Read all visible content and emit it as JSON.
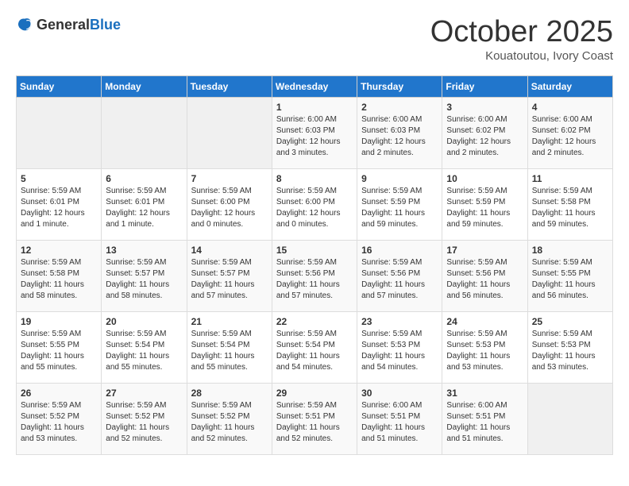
{
  "header": {
    "logo_general": "General",
    "logo_blue": "Blue",
    "title": "October 2025",
    "subtitle": "Kouatoutou, Ivory Coast"
  },
  "days_of_week": [
    "Sunday",
    "Monday",
    "Tuesday",
    "Wednesday",
    "Thursday",
    "Friday",
    "Saturday"
  ],
  "weeks": [
    [
      {
        "day": "",
        "info": ""
      },
      {
        "day": "",
        "info": ""
      },
      {
        "day": "",
        "info": ""
      },
      {
        "day": "1",
        "info": "Sunrise: 6:00 AM\nSunset: 6:03 PM\nDaylight: 12 hours\nand 3 minutes."
      },
      {
        "day": "2",
        "info": "Sunrise: 6:00 AM\nSunset: 6:03 PM\nDaylight: 12 hours\nand 2 minutes."
      },
      {
        "day": "3",
        "info": "Sunrise: 6:00 AM\nSunset: 6:02 PM\nDaylight: 12 hours\nand 2 minutes."
      },
      {
        "day": "4",
        "info": "Sunrise: 6:00 AM\nSunset: 6:02 PM\nDaylight: 12 hours\nand 2 minutes."
      }
    ],
    [
      {
        "day": "5",
        "info": "Sunrise: 5:59 AM\nSunset: 6:01 PM\nDaylight: 12 hours\nand 1 minute."
      },
      {
        "day": "6",
        "info": "Sunrise: 5:59 AM\nSunset: 6:01 PM\nDaylight: 12 hours\nand 1 minute."
      },
      {
        "day": "7",
        "info": "Sunrise: 5:59 AM\nSunset: 6:00 PM\nDaylight: 12 hours\nand 0 minutes."
      },
      {
        "day": "8",
        "info": "Sunrise: 5:59 AM\nSunset: 6:00 PM\nDaylight: 12 hours\nand 0 minutes."
      },
      {
        "day": "9",
        "info": "Sunrise: 5:59 AM\nSunset: 5:59 PM\nDaylight: 11 hours\nand 59 minutes."
      },
      {
        "day": "10",
        "info": "Sunrise: 5:59 AM\nSunset: 5:59 PM\nDaylight: 11 hours\nand 59 minutes."
      },
      {
        "day": "11",
        "info": "Sunrise: 5:59 AM\nSunset: 5:58 PM\nDaylight: 11 hours\nand 59 minutes."
      }
    ],
    [
      {
        "day": "12",
        "info": "Sunrise: 5:59 AM\nSunset: 5:58 PM\nDaylight: 11 hours\nand 58 minutes."
      },
      {
        "day": "13",
        "info": "Sunrise: 5:59 AM\nSunset: 5:57 PM\nDaylight: 11 hours\nand 58 minutes."
      },
      {
        "day": "14",
        "info": "Sunrise: 5:59 AM\nSunset: 5:57 PM\nDaylight: 11 hours\nand 57 minutes."
      },
      {
        "day": "15",
        "info": "Sunrise: 5:59 AM\nSunset: 5:56 PM\nDaylight: 11 hours\nand 57 minutes."
      },
      {
        "day": "16",
        "info": "Sunrise: 5:59 AM\nSunset: 5:56 PM\nDaylight: 11 hours\nand 57 minutes."
      },
      {
        "day": "17",
        "info": "Sunrise: 5:59 AM\nSunset: 5:56 PM\nDaylight: 11 hours\nand 56 minutes."
      },
      {
        "day": "18",
        "info": "Sunrise: 5:59 AM\nSunset: 5:55 PM\nDaylight: 11 hours\nand 56 minutes."
      }
    ],
    [
      {
        "day": "19",
        "info": "Sunrise: 5:59 AM\nSunset: 5:55 PM\nDaylight: 11 hours\nand 55 minutes."
      },
      {
        "day": "20",
        "info": "Sunrise: 5:59 AM\nSunset: 5:54 PM\nDaylight: 11 hours\nand 55 minutes."
      },
      {
        "day": "21",
        "info": "Sunrise: 5:59 AM\nSunset: 5:54 PM\nDaylight: 11 hours\nand 55 minutes."
      },
      {
        "day": "22",
        "info": "Sunrise: 5:59 AM\nSunset: 5:54 PM\nDaylight: 11 hours\nand 54 minutes."
      },
      {
        "day": "23",
        "info": "Sunrise: 5:59 AM\nSunset: 5:53 PM\nDaylight: 11 hours\nand 54 minutes."
      },
      {
        "day": "24",
        "info": "Sunrise: 5:59 AM\nSunset: 5:53 PM\nDaylight: 11 hours\nand 53 minutes."
      },
      {
        "day": "25",
        "info": "Sunrise: 5:59 AM\nSunset: 5:53 PM\nDaylight: 11 hours\nand 53 minutes."
      }
    ],
    [
      {
        "day": "26",
        "info": "Sunrise: 5:59 AM\nSunset: 5:52 PM\nDaylight: 11 hours\nand 53 minutes."
      },
      {
        "day": "27",
        "info": "Sunrise: 5:59 AM\nSunset: 5:52 PM\nDaylight: 11 hours\nand 52 minutes."
      },
      {
        "day": "28",
        "info": "Sunrise: 5:59 AM\nSunset: 5:52 PM\nDaylight: 11 hours\nand 52 minutes."
      },
      {
        "day": "29",
        "info": "Sunrise: 5:59 AM\nSunset: 5:51 PM\nDaylight: 11 hours\nand 52 minutes."
      },
      {
        "day": "30",
        "info": "Sunrise: 6:00 AM\nSunset: 5:51 PM\nDaylight: 11 hours\nand 51 minutes."
      },
      {
        "day": "31",
        "info": "Sunrise: 6:00 AM\nSunset: 5:51 PM\nDaylight: 11 hours\nand 51 minutes."
      },
      {
        "day": "",
        "info": ""
      }
    ]
  ]
}
